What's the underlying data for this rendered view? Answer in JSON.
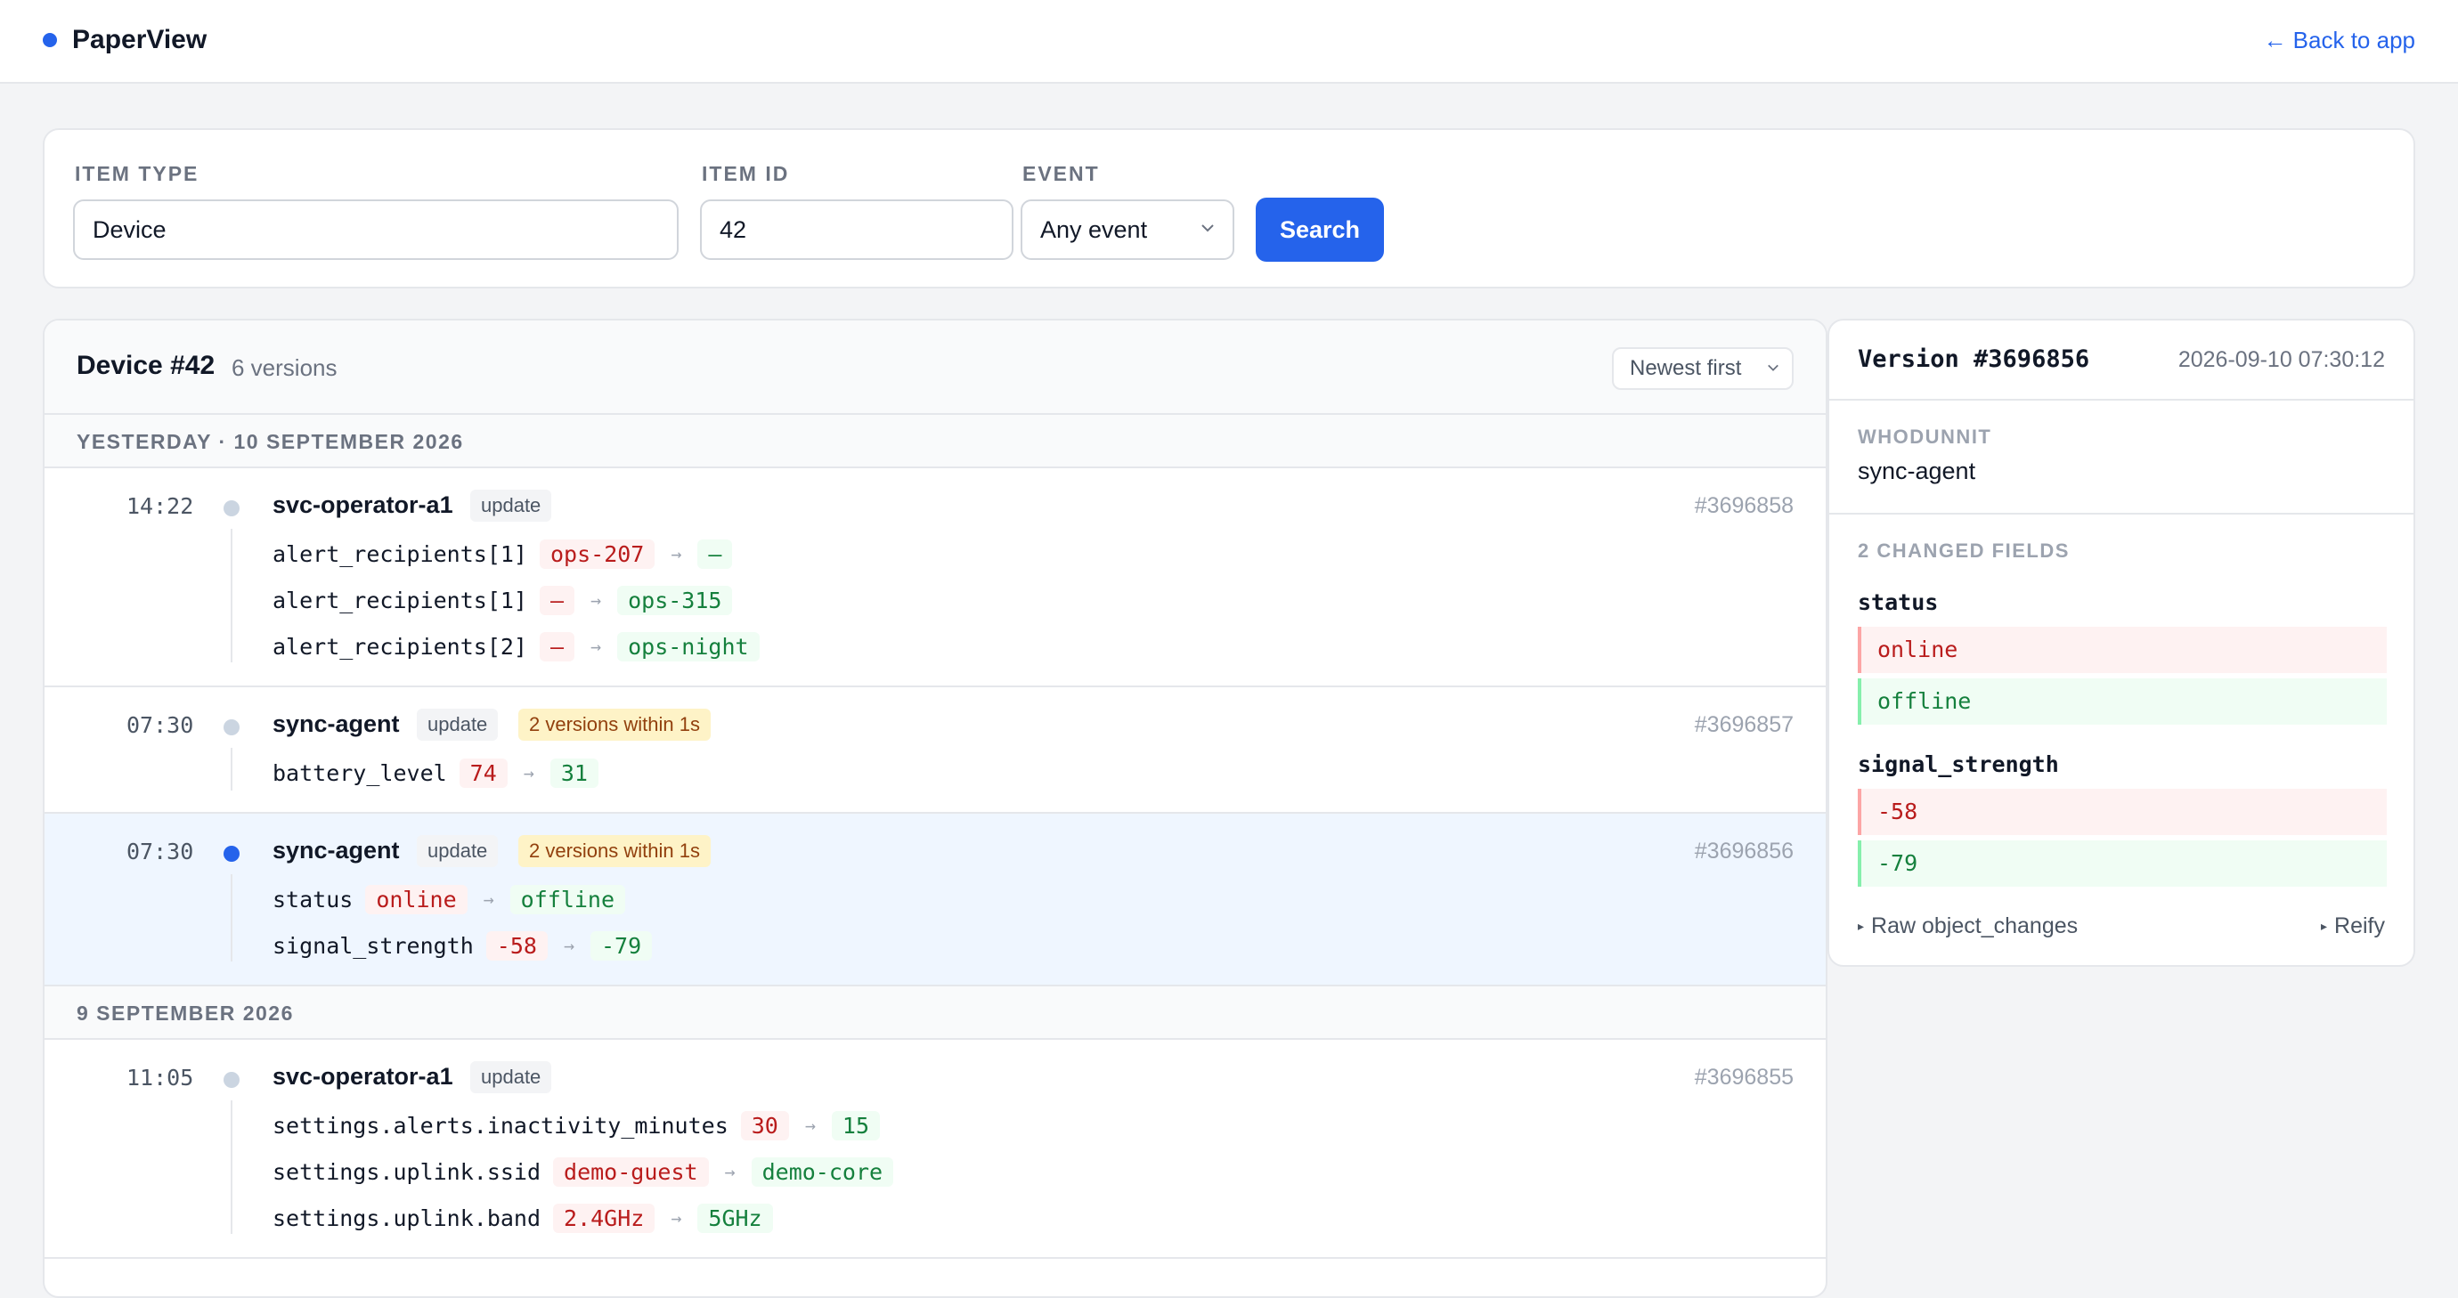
{
  "app": {
    "name": "PaperView",
    "back_link": "← Back to app"
  },
  "filters": {
    "item_type": {
      "label": "ITEM TYPE",
      "value": "Device"
    },
    "item_id": {
      "label": "ITEM ID",
      "value": "42"
    },
    "event": {
      "label": "EVENT",
      "value": "Any event"
    },
    "search_label": "Search"
  },
  "versions_panel": {
    "title": "Device #42",
    "count": "6 versions",
    "sort": "Newest first",
    "days": [
      {
        "label": "YESTERDAY · 10 SEPTEMBER 2026",
        "versions": [
          {
            "time": "14:22",
            "actor": "svc-operator-a1",
            "event": "update",
            "badge": "",
            "id": "#3696858",
            "changes": [
              {
                "field": "alert_recipients[1]",
                "old": "ops-207",
                "new": "—"
              },
              {
                "field": "alert_recipients[1]",
                "old": "—",
                "new": "ops-315"
              },
              {
                "field": "alert_recipients[2]",
                "old": "—",
                "new": "ops-night"
              }
            ]
          },
          {
            "time": "07:30",
            "actor": "sync-agent",
            "event": "update",
            "badge": "2 versions within 1s",
            "id": "#3696857",
            "changes": [
              {
                "field": "battery_level",
                "old": "74",
                "new": "31"
              }
            ]
          },
          {
            "time": "07:30",
            "actor": "sync-agent",
            "event": "update",
            "badge": "2 versions within 1s",
            "id": "#3696856",
            "changes": [
              {
                "field": "status",
                "old": "online",
                "new": "offline"
              },
              {
                "field": "signal_strength",
                "old": "-58",
                "new": "-79"
              }
            ]
          }
        ]
      },
      {
        "label": "9 SEPTEMBER 2026",
        "versions": [
          {
            "time": "11:05",
            "actor": "svc-operator-a1",
            "event": "update",
            "badge": "",
            "id": "#3696855",
            "changes": [
              {
                "field": "settings.alerts.inactivity_minutes",
                "old": "30",
                "new": "15"
              },
              {
                "field": "settings.uplink.ssid",
                "old": "demo-guest",
                "new": "demo-core"
              },
              {
                "field": "settings.uplink.band",
                "old": "2.4GHz",
                "new": "5GHz"
              }
            ]
          }
        ]
      }
    ]
  },
  "detail": {
    "title": "Version #3696856",
    "timestamp": "2026-09-10 07:30:12",
    "whodunnit_label": "WHODUNNIT",
    "whodunnit": "sync-agent",
    "changed_label": "2 CHANGED FIELDS",
    "fields": [
      {
        "name": "status",
        "old": "online",
        "new": "offline"
      },
      {
        "name": "signal_strength",
        "old": "-58",
        "new": "-79"
      }
    ],
    "raw_link": "Raw object_changes",
    "reify_link": "Reify"
  },
  "colors": {
    "accent": "#2563eb",
    "old_bg": "#fef2f2",
    "new_bg": "#f0fdf4",
    "warn_bg": "#fef3c7"
  }
}
